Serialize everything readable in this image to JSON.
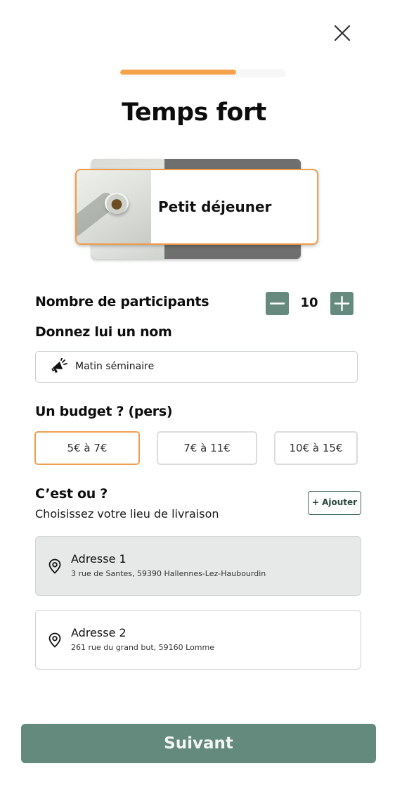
{
  "header": {
    "title": "Temps fort",
    "close_icon": "close-icon",
    "progress": 0.7
  },
  "colors": {
    "accent": "#f7a14a",
    "primary": "#638a7c",
    "selected_border": "#ef9e4f"
  },
  "event_card": {
    "label": "Petit déjeuner"
  },
  "participants": {
    "label": "Nombre de participants",
    "value": "10",
    "minus_icon": "minus-icon",
    "plus_icon": "plus-icon"
  },
  "name": {
    "label": "Donnez lui un nom",
    "value": "Matin séminaire",
    "icon": "megaphone-icon"
  },
  "budget": {
    "label": "Un budget ? (pers)",
    "options": [
      "5€ à 7€",
      "7€ à 11€",
      "10€ à 15€"
    ],
    "selected": "5€ à 7€"
  },
  "location": {
    "title": "C’est ou ?",
    "subtitle": "Choisissez votre lieu de livraison",
    "add_label": "+ Ajouter",
    "addresses": [
      {
        "name": "Adresse 1",
        "detail": "3 rue de Santes, 59390 Hallennes-Lez-Haubourdin",
        "selected": true
      },
      {
        "name": "Adresse 2",
        "detail": "261 rue du grand but, 59160 Lomme",
        "selected": false
      }
    ]
  },
  "footer": {
    "next_label": "Suivant"
  }
}
